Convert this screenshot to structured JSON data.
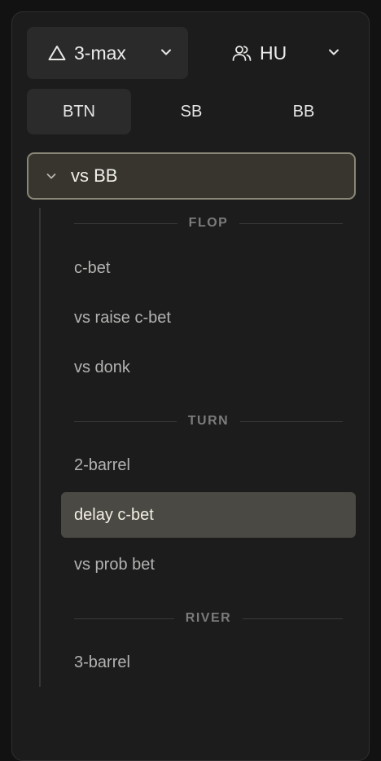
{
  "mode_select": {
    "icon": "triangle-icon",
    "label": "3-max"
  },
  "players_select": {
    "icon": "users-icon",
    "label": "HU"
  },
  "position_tabs": [
    {
      "label": "BTN",
      "active": true
    },
    {
      "label": "SB",
      "active": false
    },
    {
      "label": "BB",
      "active": false
    }
  ],
  "group": {
    "label": "vs BB",
    "expanded": true
  },
  "sections": [
    {
      "title": "FLOP",
      "items": [
        "c-bet",
        "vs raise c-bet",
        "vs donk"
      ]
    },
    {
      "title": "TURN",
      "items": [
        "2-barrel",
        "delay c-bet",
        "vs prob bet"
      ]
    },
    {
      "title": "RIVER",
      "items": [
        "3-barrel"
      ]
    }
  ],
  "active_item": "delay c-bet",
  "colors": {
    "background": "#121212",
    "panel": "#1c1c1c",
    "active_item_bg": "#4a4943",
    "group_border": "#8a8777"
  }
}
